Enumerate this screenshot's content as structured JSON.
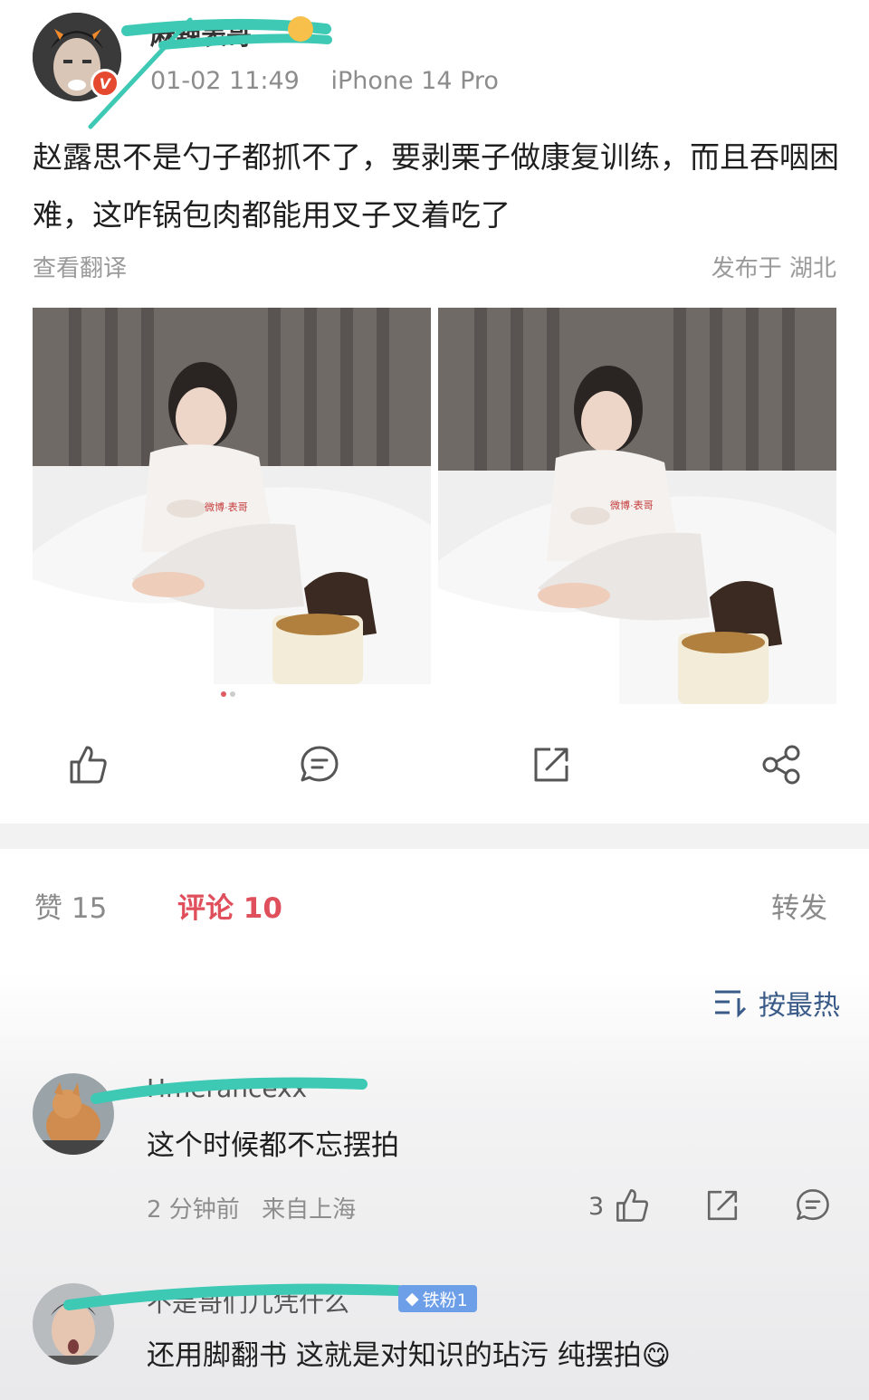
{
  "post": {
    "username": "麻辣表哥",
    "time": "01-02 11:49",
    "device": "iPhone 14 Pro",
    "verified_mark": "V",
    "text": "赵露思不是勺子都抓不了，要剥栗子做康复训练，而且吞咽困难，这咋锅包肉都能用叉子叉着吃了",
    "translate_label": "查看翻译",
    "location": "发布于 湖北",
    "image_watermark": "微博·表哥"
  },
  "tabs": {
    "likes": "赞 15",
    "comments": "评论 10",
    "reposts": "转发"
  },
  "sort_label": "按最热",
  "comments": [
    {
      "name": "Hmerancexx",
      "text": "这个时候都不忘摆拍",
      "time": "2 分钟前",
      "from": "来自上海",
      "likes": "3"
    },
    {
      "name": "不是哥们儿凭什么",
      "badge": "铁粉1",
      "text": "还用脚翻书 这就是对知识的玷污 纯摆拍",
      "emoji": "😋"
    }
  ],
  "colors": {
    "accent": "#e0505c",
    "scribble": "#3ec9b4",
    "link_blue": "#3a5a88",
    "badge_blue": "#6d9fe9"
  },
  "icons": [
    "like-icon",
    "comment-icon",
    "repost-icon",
    "share-icon",
    "sort-icon"
  ]
}
